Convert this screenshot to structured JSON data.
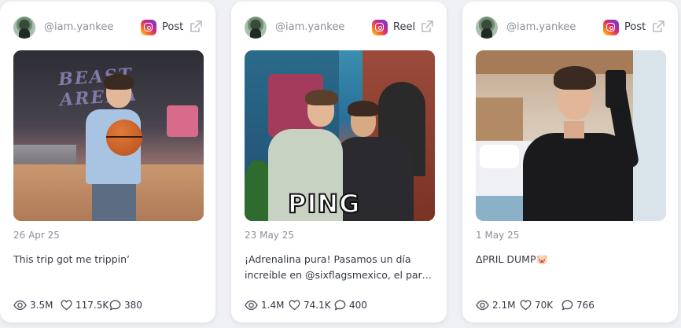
{
  "cards": [
    {
      "handle": "@iam.yankee",
      "type": "Post",
      "date": "26 Apr 25",
      "caption": [
        "This trip got me trippin’"
      ],
      "views": "3.5M",
      "likes": "117.5K",
      "comments": "380"
    },
    {
      "handle": "@iam.yankee",
      "type": "Reel",
      "date": "23 May 25",
      "caption": [
        "¡Adrenalina pura! Pasamos un día",
        "increíble en @sixflagsmexico, el parque..."
      ],
      "overlay_text": "PING",
      "views": "1.4M",
      "likes": "74.1K",
      "comments": "400"
    },
    {
      "handle": "@iam.yankee",
      "type": "Post",
      "date": "1 May 25",
      "caption": [
        "ΔPRIL DUMP🐷"
      ],
      "views": "2.1M",
      "likes": "70K",
      "comments": "766"
    }
  ],
  "icons": {
    "platform": "instagram-icon",
    "open": "external-link-icon",
    "views": "eye-icon",
    "likes": "heart-icon",
    "comments": "comment-icon"
  },
  "colors": {
    "background": "#eef0f4",
    "card": "#ffffff",
    "muted_text": "#8b8f99",
    "text": "#333846"
  }
}
